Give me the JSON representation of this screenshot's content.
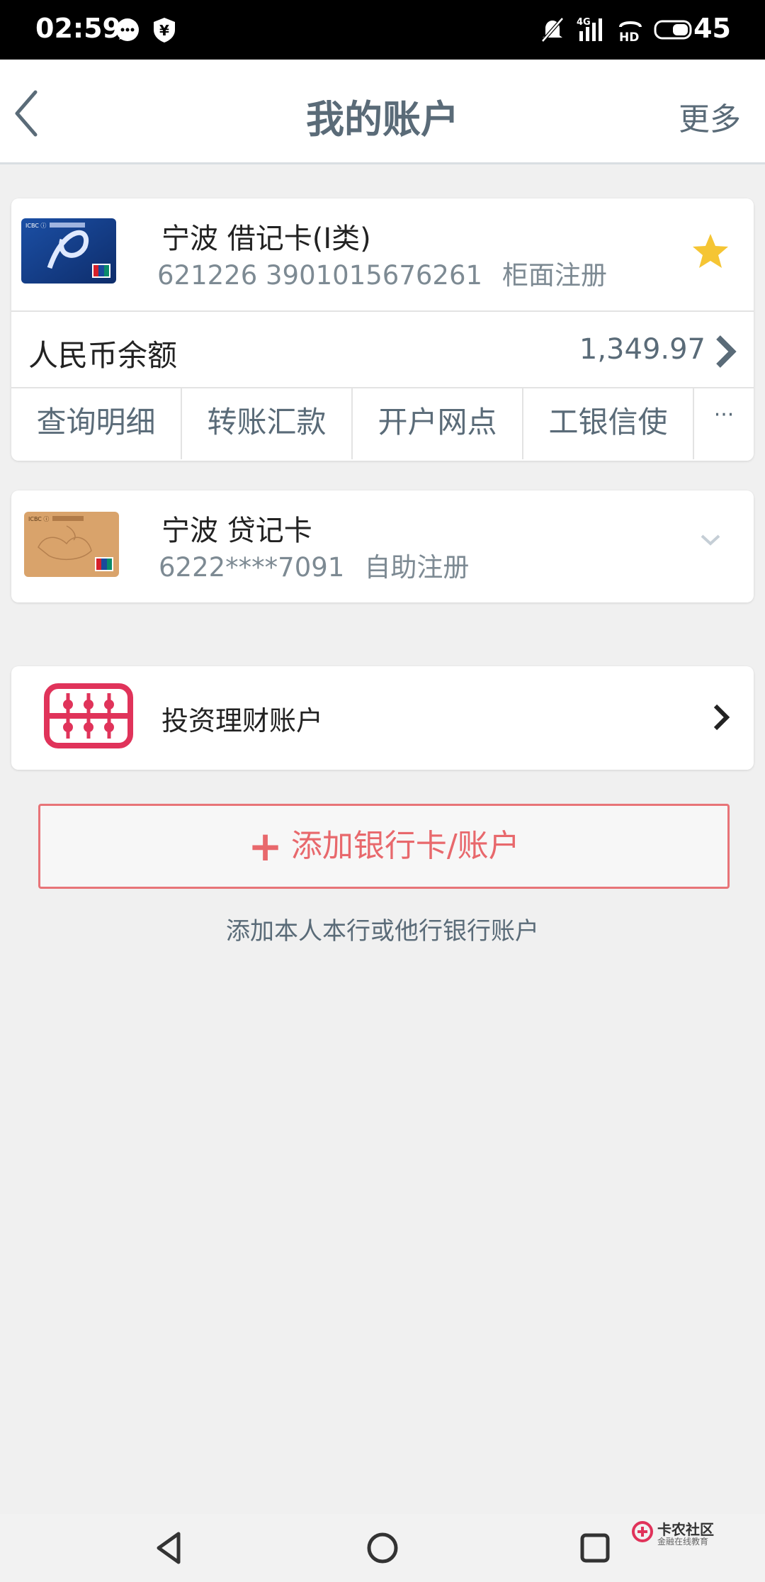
{
  "status_bar": {
    "time": "02:59",
    "battery": "45",
    "icons": [
      "chat-bubble-icon",
      "shield-icon",
      "mute-icon",
      "signal-4g-icon",
      "hd-icon",
      "battery-icon"
    ]
  },
  "nav": {
    "title": "我的账户",
    "more": "更多"
  },
  "debit_card": {
    "name": "宁波 借记卡(I类)",
    "number": "621226 3901015676261",
    "registration": "柜面注册",
    "favorite": true,
    "balance_label": "人民币余额",
    "balance_value": "1,349.97",
    "actions": [
      "查询明细",
      "转账汇款",
      "开户网点",
      "工银信使"
    ],
    "actions_more": "···"
  },
  "credit_card": {
    "name": "宁波 贷记卡",
    "number": "6222****7091",
    "registration": "自助注册"
  },
  "invest": {
    "label": "投资理财账户"
  },
  "add": {
    "plus": "+",
    "label": "添加银行卡/账户",
    "hint": "添加本人本行或他行银行账户"
  },
  "watermark": {
    "title": "卡农社区",
    "subtitle": "金融在线教育"
  },
  "colors": {
    "accent_red": "#e8686c",
    "text_slate": "#5a6b78",
    "star": "#f5c534",
    "invest_icon": "#e0335a"
  }
}
